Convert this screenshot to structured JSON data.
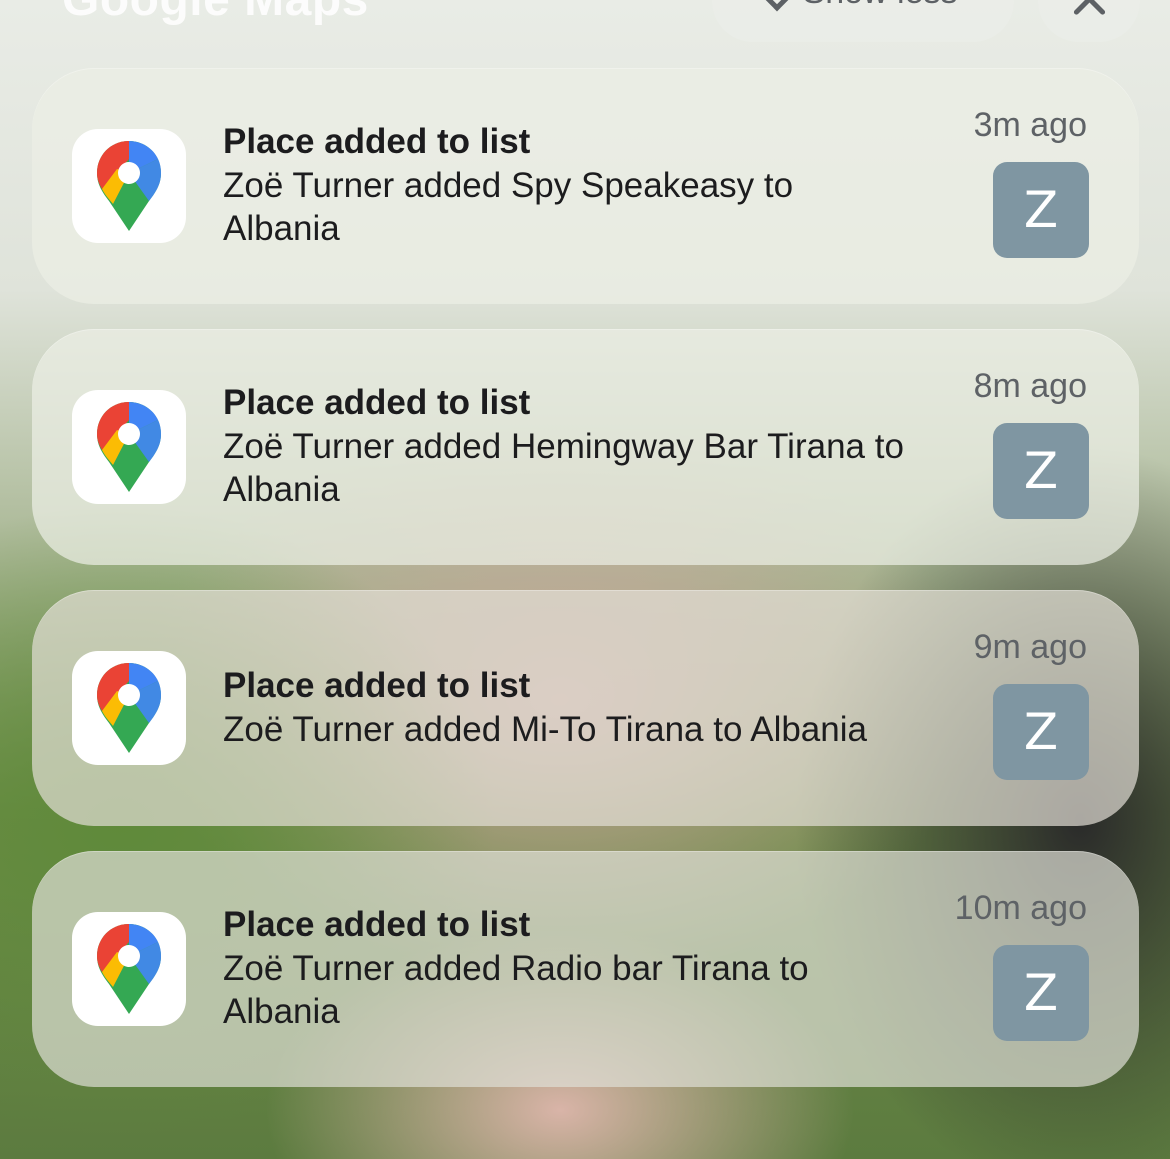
{
  "header": {
    "app_title": "Google Maps",
    "show_less_label": "Show less"
  },
  "notifications": [
    {
      "title": "Place added to list",
      "body": "Zoë Turner added Spy Speakeasy to Albania",
      "time": "3m ago",
      "avatar_initial": "Z"
    },
    {
      "title": "Place added to list",
      "body": "Zoë Turner added Hemingway Bar Tirana to Albania",
      "time": "8m ago",
      "avatar_initial": "Z"
    },
    {
      "title": "Place added to list",
      "body": "Zoë Turner added Mi-To Tirana to Albania",
      "time": "9m ago",
      "avatar_initial": "Z"
    },
    {
      "title": "Place added to list",
      "body": "Zoë Turner added Radio bar Tirana to Albania",
      "time": "10m ago",
      "avatar_initial": "Z"
    }
  ],
  "icons": {
    "app_icon": "google-maps-pin-icon",
    "show_less_icon": "chevron-up-icon",
    "close_icon": "close-icon"
  },
  "colors": {
    "avatar_bg": "#7f96a2",
    "pin_red": "#ea4335",
    "pin_blue": "#4285f4",
    "pin_yellow": "#fbbc04",
    "pin_green": "#34a853"
  }
}
